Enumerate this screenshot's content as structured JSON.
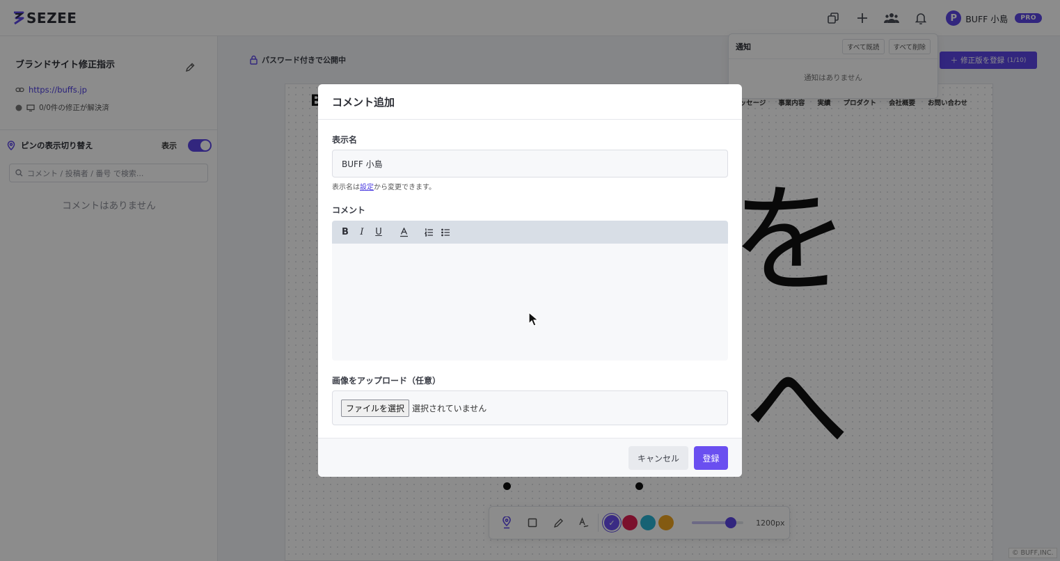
{
  "header": {
    "logo_text": "SEZEE",
    "user_name": "BUFF 小島",
    "user_initial": "P",
    "plan_badge": "PRO"
  },
  "sidebar": {
    "project_title": "ブランドサイト修正指示",
    "site_url": "https://buffs.jp",
    "resolved_text": "0/0件の修正が解決済",
    "pin_toggle_label": "ピンの表示切り替え",
    "pin_toggle_state": "表示",
    "search_placeholder": "コメント / 投稿者 / 番号 で検索...",
    "empty_text": "コメントはありません"
  },
  "main": {
    "password_label": "パスワード付きで公開中",
    "revise_button": "修正版を登録",
    "revise_count": "(1/10)",
    "site_logo": "B",
    "site_nav": [
      "メッセージ",
      "事業内容",
      "実績",
      "プロダクト",
      "会社概要",
      "お問い合わせ"
    ],
    "handwriting": [
      "を",
      "へ"
    ],
    "copyright": "© BUFF,INC."
  },
  "notifications": {
    "title": "通知",
    "mark_all_read": "すべて既読",
    "delete_all": "すべて削除",
    "empty_text": "通知はありません"
  },
  "draw_toolbar": {
    "tools": [
      "pin-icon",
      "rectangle-icon",
      "pen-icon",
      "text-icon"
    ],
    "colors": [
      "#6a4ff0",
      "#e01e50",
      "#29b3d4",
      "#eea420"
    ],
    "selected_color": "#6a4ff0",
    "stroke_level": 0.75,
    "width_value": "1200px"
  },
  "modal": {
    "title": "コメント追加",
    "display_name_label": "表示名",
    "display_name_value": "BUFF 小島",
    "hint_prefix": "表示名は",
    "hint_link": "設定",
    "hint_suffix": "から変更できます。",
    "comment_label": "コメント",
    "editor_tools": [
      "bold-icon",
      "italic-icon",
      "underline-icon",
      "text-color-icon",
      "ordered-list-icon",
      "bullet-list-icon"
    ],
    "upload_label": "画像をアップロード（任意）",
    "file_button": "ファイルを選択",
    "file_status": "選択されていません",
    "cancel_button": "キャンセル",
    "submit_button": "登録"
  },
  "colors": {
    "accent": "#5b45e6",
    "overlay": "rgba(0,0,0,0.45)"
  }
}
